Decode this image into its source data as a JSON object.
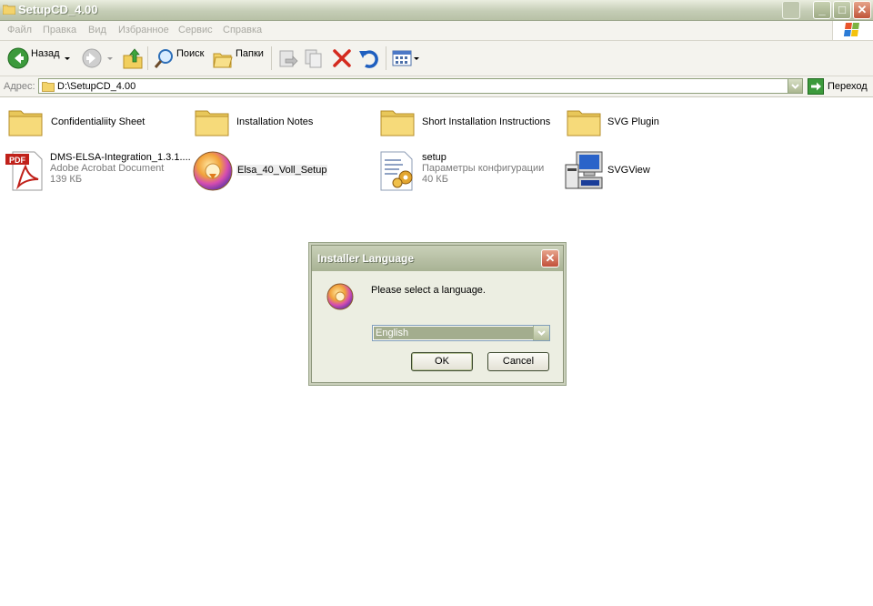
{
  "window": {
    "title": "SetupCD_4.00",
    "controls": {
      "minimize": "_",
      "maximize": "□",
      "close": "✕"
    }
  },
  "menubar": {
    "items": [
      "Файл",
      "Правка",
      "Вид",
      "Избранное",
      "Сервис",
      "Справка"
    ]
  },
  "toolbar": {
    "back_label": "Назад",
    "search_label": "Поиск",
    "folders_label": "Папки",
    "icons": [
      "back-arrow-icon",
      "forward-arrow-icon",
      "up-folder-icon",
      "search-icon",
      "folders-icon",
      "move-to-icon",
      "copy-to-icon",
      "delete-icon",
      "undo-icon",
      "views-icon"
    ]
  },
  "address": {
    "label": "Адрес:",
    "value": "D:\\SetupCD_4.00",
    "go_label": "Переход"
  },
  "files": [
    {
      "name": "Confidentialiity Sheet",
      "type": "folder"
    },
    {
      "name": "Installation Notes",
      "type": "folder"
    },
    {
      "name": "Short Installation Instructions",
      "type": "folder"
    },
    {
      "name": "SVG Plugin",
      "type": "folder"
    },
    {
      "name": "DMS-ELSA-Integration_1.3.1....",
      "line2": "Adobe Acrobat Document",
      "line3": "139 КБ",
      "type": "pdf"
    },
    {
      "name": "Elsa_40_Voll_Setup",
      "type": "installer"
    },
    {
      "name": "setup",
      "line2": "Параметры конфигурации",
      "line3": "40 КБ",
      "type": "config"
    },
    {
      "name": "SVGView",
      "type": "application"
    }
  ],
  "dialog": {
    "title": "Installer Language",
    "message": "Please select a language.",
    "selected_language": "English",
    "ok_label": "OK",
    "cancel_label": "Cancel",
    "close_glyph": "✕"
  }
}
